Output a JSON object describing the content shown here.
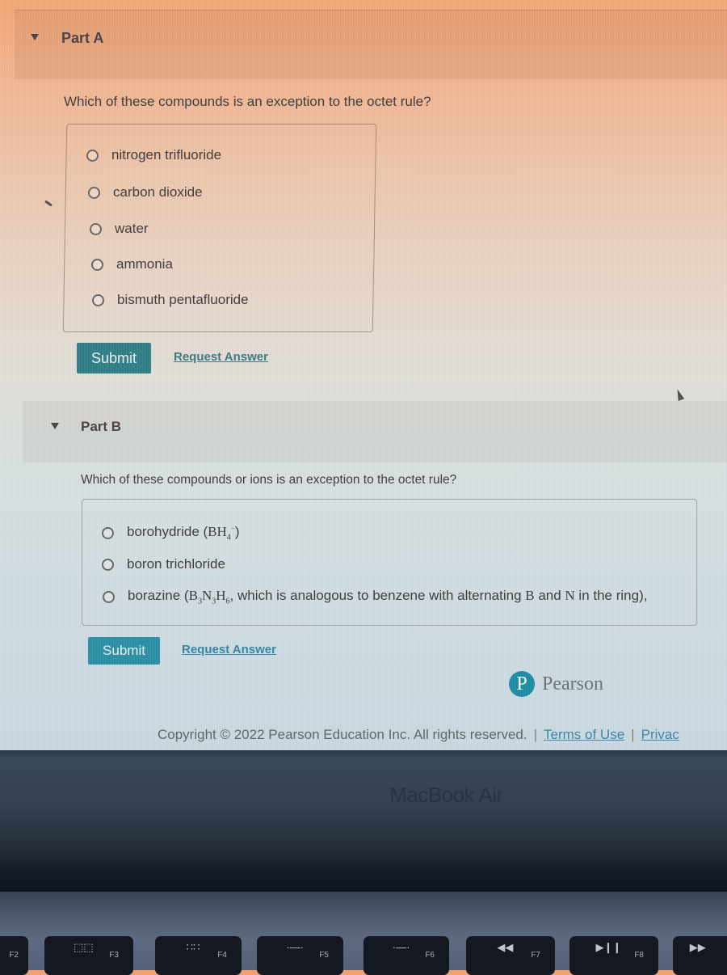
{
  "partA": {
    "title": "Part A",
    "question": "Which of these compounds is an exception to the octet rule?",
    "choices": [
      "nitrogen trifluoride",
      "carbon dioxide",
      "water",
      "ammonia",
      "bismuth pentafluoride"
    ],
    "submit_label": "Submit",
    "request_answer_label": "Request Answer"
  },
  "partB": {
    "title": "Part B",
    "question": "Which of these compounds or ions is an exception to the octet rule?",
    "choices": [
      {
        "text": "borohydride (",
        "formula": "BH",
        "sub": "4",
        "sup": "−",
        "after": ")"
      },
      {
        "text": "boron trichloride"
      },
      {
        "text": "borazine (",
        "formula_parts": [
          "B",
          "3",
          "N",
          "3",
          "H",
          "6"
        ],
        "after": ", which is analogous to benzene with alternating ",
        "b": "B",
        "and": " and ",
        "n": "N",
        "tail": " in the ring),"
      }
    ],
    "submit_label": "Submit",
    "request_answer_label": "Request Answer"
  },
  "brand": {
    "logo_letter": "P",
    "name": "Pearson"
  },
  "footer": {
    "copyright": "Copyright © 2022 Pearson Education Inc. All rights reserved.",
    "separator": "|",
    "terms_label": "Terms of Use",
    "privacy_label": "Privac"
  },
  "laptop": {
    "model_label": "MacBook Air",
    "keys": [
      {
        "label": "F2",
        "glyph": ""
      },
      {
        "label": "F3",
        "glyph": "⬚⬚",
        "icon": "mission-control-icon"
      },
      {
        "label": "F4",
        "glyph": "∷∷",
        "icon": "launchpad-icon"
      },
      {
        "label": "F5",
        "glyph": "·―·",
        "icon": "keyboard-brightness-down-icon"
      },
      {
        "label": "F6",
        "glyph": "·―·",
        "icon": "keyboard-brightness-up-icon"
      },
      {
        "label": "F7",
        "glyph": "◀◀",
        "icon": "rewind-icon"
      },
      {
        "label": "F8",
        "glyph": "▶❙❙",
        "icon": "play-pause-icon"
      },
      {
        "label": "",
        "glyph": "▶▶",
        "icon": "fast-forward-icon"
      }
    ]
  }
}
